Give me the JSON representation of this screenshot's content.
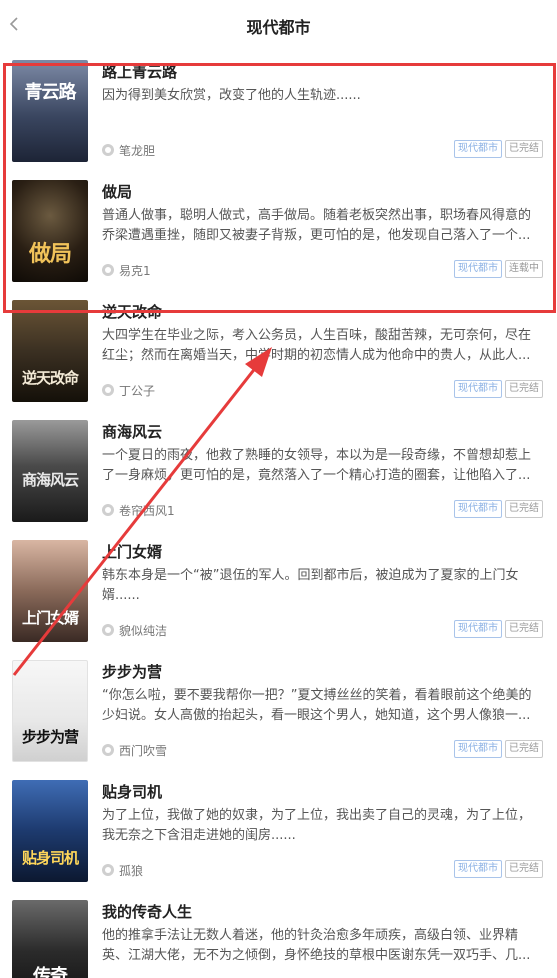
{
  "header": {
    "title": "现代都市",
    "back_icon": "chevron-left-icon"
  },
  "books": [
    {
      "title": "路上青云路",
      "desc": "因为得到美女欣赏，改变了他的人生轨迹......",
      "author": "笔龙胆",
      "category": "现代都市",
      "status": "已完结",
      "cover_text": "青云路",
      "cover_bg": "#3a4660"
    },
    {
      "title": "做局",
      "desc": "普通人做事，聪明人做式，高手做局。随着老板突然出事，职场春风得意的乔梁遭遇重挫，随即又被妻子背叛，更可怕的是，他发现自己落入了一个...",
      "author": "易克1",
      "category": "现代都市",
      "status": "连载中",
      "cover_text": "做局",
      "cover_bg": "#2a1f14"
    },
    {
      "title": "逆天改命",
      "desc": "大四学生在毕业之际，考入公务员，人生百味，酸甜苦辣，无可奈何，尽在红尘；然而在离婚当天，中学时期的初恋情人成为他命中的贵人，从此人...",
      "author": "丁公子",
      "category": "现代都市",
      "status": "已完结",
      "cover_text": "逆天改命",
      "cover_bg": "#3b3022"
    },
    {
      "title": "商海风云",
      "desc": "一个夏日的雨夜，他救了熟睡的女领导，本以为是一段奇缘，不曾想却惹上了一身麻烦，更可怕的是，竟然落入了一个精心打造的圈套，让他陷入了...",
      "author": "卷帘西风1",
      "category": "现代都市",
      "status": "已完结",
      "cover_text": "商海风云",
      "cover_bg": "#4a4a4a"
    },
    {
      "title": "上门女婿",
      "desc": "韩东本身是一个“被”退伍的军人。回到都市后，被迫成为了夏家的上门女婿......",
      "author": "貌似纯洁",
      "category": "现代都市",
      "status": "已完结",
      "cover_text": "上门女婿",
      "cover_bg": "#8a6a5a"
    },
    {
      "title": "步步为营",
      "desc": "“你怎么啦，要不要我帮你一把？”夏文搏丝丝的笑着，看着眼前这个绝美的少妇说。女人高傲的抬起头，看一眼这个男人，她知道，这个男人像狼一...",
      "author": "西门吹雪",
      "category": "现代都市",
      "status": "已完结",
      "cover_text": "步步为营",
      "cover_bg": "#e8e8e8"
    },
    {
      "title": "贴身司机",
      "desc": "为了上位，我做了她的奴隶，为了上位，我出卖了自己的灵魂，为了上位，我无奈之下含泪走进她的闺房......",
      "author": "孤狼",
      "category": "现代都市",
      "status": "已完结",
      "cover_text": "贴身司机",
      "cover_bg": "#1d3a6e"
    },
    {
      "title": "我的传奇人生",
      "desc": "他的推拿手法让无数人着迷，他的针灸治愈多年顽疾，高级白领、业界精英、江湖大佬，无不为之倾倒，身怀绝技的草根中医谢东凭一双巧手、几...",
      "author": "",
      "category": "",
      "status": "",
      "cover_text": "传奇",
      "cover_bg": "#2b2b2b"
    }
  ],
  "colors": {
    "annotation": "#e63b3b",
    "tag_category": "#8ab0e4",
    "tag_status": "#999999"
  }
}
